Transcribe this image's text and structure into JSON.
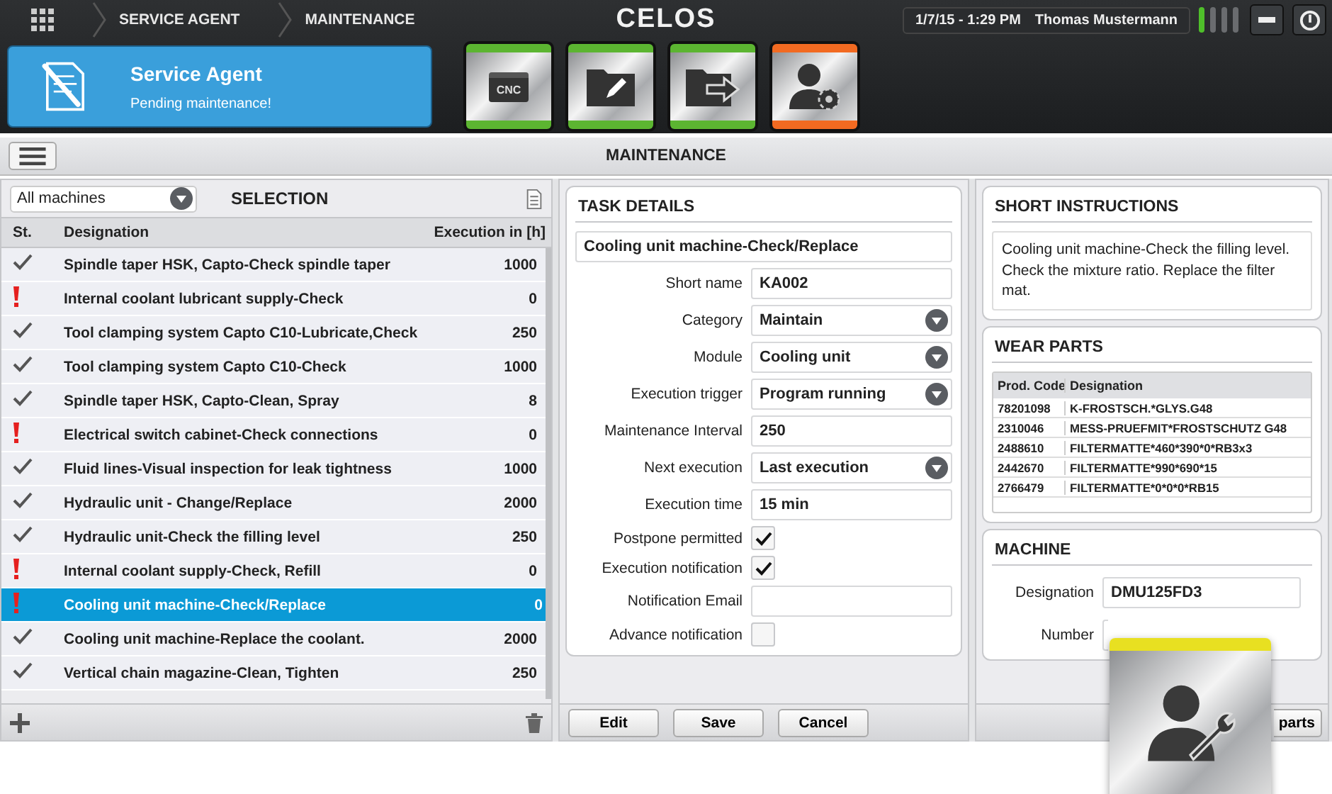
{
  "topbar": {
    "breadcrumbs": [
      "SERVICE AGENT",
      "MAINTENANCE"
    ],
    "logo": "CELOS",
    "datetime": "1/7/15 - 1:29 PM",
    "user": "Thomas Mustermann"
  },
  "notification": {
    "title": "Service Agent",
    "message": "Pending maintenance!"
  },
  "app_tiles": [
    {
      "kind": "cnc",
      "label": "CNC",
      "color": "#5cb531"
    },
    {
      "kind": "folder-edit",
      "color": "#5cb531"
    },
    {
      "kind": "folder-export",
      "color": "#5cb531"
    },
    {
      "kind": "user-settings",
      "color": "#f26a21"
    }
  ],
  "page_title": "MAINTENANCE",
  "selection": {
    "filter": "All machines",
    "title": "SELECTION",
    "columns": [
      "St.",
      "Designation",
      "Execution in [h]"
    ],
    "rows": [
      {
        "kind": "ok",
        "designation": "Spindle taper HSK, Capto-Check spindle taper",
        "hours": "1000",
        "selected": false
      },
      {
        "kind": "due",
        "designation": "Internal coolant lubricant supply-Check",
        "hours": "0",
        "selected": false
      },
      {
        "kind": "ok",
        "designation": "Tool clamping system Capto C10-Lubricate,Check",
        "hours": "250",
        "selected": false
      },
      {
        "kind": "ok",
        "designation": "Tool clamping system Capto C10-Check",
        "hours": "1000",
        "selected": false
      },
      {
        "kind": "ok",
        "designation": "Spindle taper HSK, Capto-Clean, Spray",
        "hours": "8",
        "selected": false
      },
      {
        "kind": "due",
        "designation": "Electrical switch cabinet-Check connections",
        "hours": "0",
        "selected": false
      },
      {
        "kind": "ok",
        "designation": "Fluid lines-Visual inspection for leak tightness",
        "hours": "1000",
        "selected": false
      },
      {
        "kind": "ok",
        "designation": "Hydraulic unit - Change/Replace",
        "hours": "2000",
        "selected": false
      },
      {
        "kind": "ok",
        "designation": "Hydraulic unit-Check the filling level",
        "hours": "250",
        "selected": false
      },
      {
        "kind": "due",
        "designation": "Internal coolant supply-Check, Refill",
        "hours": "0",
        "selected": false
      },
      {
        "kind": "due",
        "designation": "Cooling unit machine-Check/Replace",
        "hours": "0",
        "selected": true
      },
      {
        "kind": "ok",
        "designation": "Cooling unit machine-Replace the coolant.",
        "hours": "2000",
        "selected": false
      },
      {
        "kind": "ok",
        "designation": "Vertical chain magazine-Clean, Tighten",
        "hours": "250",
        "selected": false
      }
    ]
  },
  "task_details": {
    "title": "TASK DETAILS",
    "task_name": "Cooling unit machine-Check/Replace",
    "fields": [
      {
        "kind": "text",
        "label": "Short name",
        "value": "KA002"
      },
      {
        "kind": "select",
        "label": "Category",
        "value": "Maintain"
      },
      {
        "kind": "select",
        "label": "Module",
        "value": "Cooling unit"
      },
      {
        "kind": "select",
        "label": "Execution trigger",
        "value": "Program running"
      },
      {
        "kind": "text",
        "label": "Maintenance Interval",
        "value": "250"
      },
      {
        "kind": "select",
        "label": "Next execution",
        "value": "Last execution"
      },
      {
        "kind": "text",
        "label": "Execution time",
        "value": "15 min"
      },
      {
        "kind": "checkbox",
        "label": "Postpone permitted",
        "checked": true
      },
      {
        "kind": "checkbox",
        "label": "Execution notification",
        "checked": true
      },
      {
        "kind": "text",
        "label": "Notification Email"
      },
      {
        "kind": "checkbox",
        "label": "Advance notification",
        "checked": false
      }
    ],
    "buttons": [
      "Edit",
      "Save",
      "Cancel"
    ]
  },
  "short_instructions": {
    "title": "SHORT INSTRUCTIONS",
    "text": "Cooling unit machine-Check the filling level. Check the mixture ratio. Replace the filter mat."
  },
  "wear_parts": {
    "title": "WEAR PARTS",
    "columns": [
      "Prod. Code",
      "Designation"
    ],
    "rows": [
      [
        "78201098",
        "K-FROSTSCH.*GLYS.G48"
      ],
      [
        "2310046",
        "MESS-PRUEFMIT*FROSTSCHUTZ G48"
      ],
      [
        "2488610",
        "FILTERMATTE*460*390*0*RB3x3"
      ],
      [
        "2442670",
        "FILTERMATTE*990*690*15"
      ],
      [
        "2766479",
        "FILTERMATTE*0*0*0*RB15"
      ]
    ]
  },
  "machine": {
    "title": "MACHINE",
    "fields": [
      {
        "label": "Designation",
        "value": "DMU125FD3"
      },
      {
        "label": "Number"
      }
    ]
  },
  "right_button": "parts",
  "floating_tile": {
    "kind": "user-service",
    "color": "#e8e021"
  }
}
